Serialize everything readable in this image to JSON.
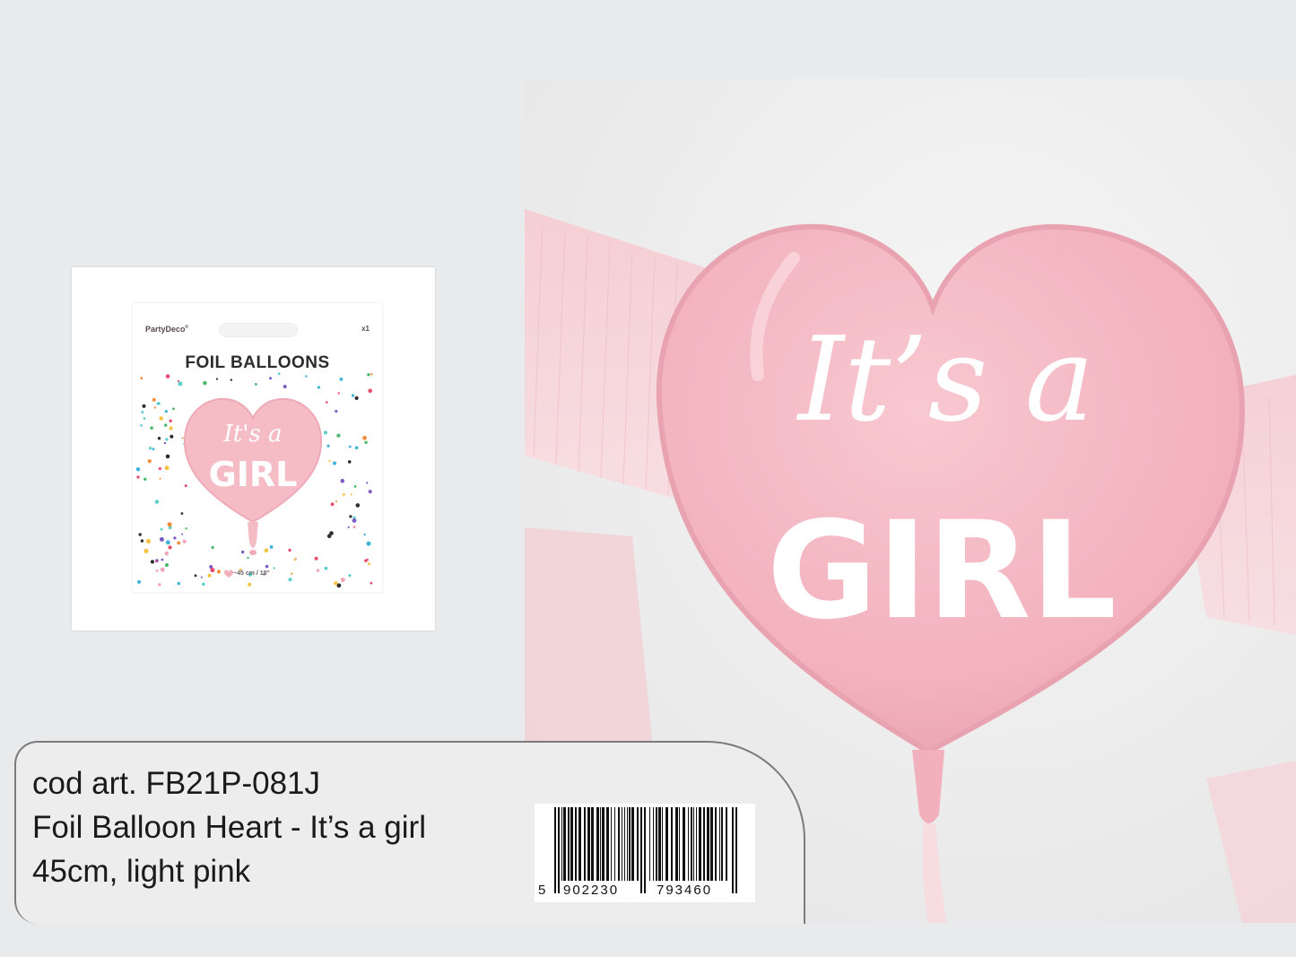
{
  "package": {
    "brand": "PartyDeco",
    "brand_mark": "®",
    "count": "x1",
    "title": "FOIL BALLOONS",
    "balloon_script": "It's a",
    "balloon_bold": "GIRL",
    "size": "~45 cm / 18\""
  },
  "photo": {
    "balloon_script": "It’s a",
    "balloon_bold": "GIRL",
    "balloon_color": "#f3b9c3",
    "backdrop_color": "#f7d6da"
  },
  "info": {
    "code_line": "cod art. FB21P-081J",
    "name_line": "Foil Balloon Heart - It’s a girl",
    "spec_line": "45cm, light pink"
  },
  "barcode": {
    "first_digit": "5",
    "left_group": "902230",
    "right_group": "793460"
  }
}
